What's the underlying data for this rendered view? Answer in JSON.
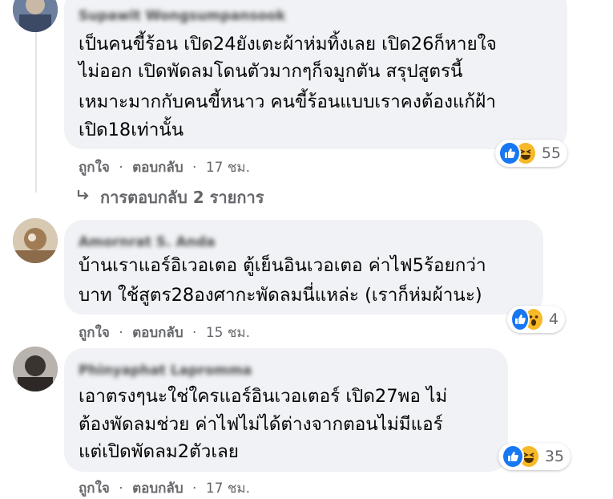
{
  "comments": [
    {
      "author": "Supawit Wongsumpansook",
      "lines": [
        "เป็นคนขี้ร้อน เปิด24ยังเตะผ้าห่มทิ้งเลย เปิด26ก็หายใจ",
        "ไม่ออก เปิดพัดลมโดนตัวมากๆก็จมูกตัน สรุปสูตรนี้",
        "เหมาะมากกับคนขี้หนาว คนขี้ร้อนแบบเราคงต้องแก้ฝ้า",
        "เปิด18เท่านั้น"
      ],
      "like_label": "ถูกใจ",
      "reply_label": "ตอบกลับ",
      "separator": "·",
      "time": "17 ชม.",
      "reaction_icons": [
        "like-icon",
        "haha-icon"
      ],
      "reaction_count": "55"
    },
    {
      "author": "Amornrat S. Anda",
      "lines": [
        "บ้านเราแอร์อิเวอเตอ ตู้เย็นอินเวอเตอ ค่าไฟ5ร้อยกว่า",
        "บาท ใช้สูตร28องศากะพัดลมนี่แหล่ะ (เราก็ห่มผ้านะ)"
      ],
      "like_label": "ถูกใจ",
      "reply_label": "ตอบกลับ",
      "separator": "·",
      "time": "15 ชม.",
      "reaction_icons": [
        "like-icon",
        "wow-icon"
      ],
      "reaction_count": "4"
    },
    {
      "author": "Phinyaphat Lapromma",
      "lines": [
        "เอาตรงๆนะใช่ใครแอร์อินเวอเตอร์ เปิด27พอ ไม่",
        "ต้องพัดลมช่วย ค่าไฟไม่ได้ต่างจากตอนไม่มีแอร์",
        "แต่เปิดพัดลม2ตัวเลย"
      ],
      "like_label": "ถูกใจ",
      "reply_label": "ตอบกลับ",
      "separator": "·",
      "time": "17 ชม.",
      "reaction_icons": [
        "like-icon",
        "haha-icon"
      ],
      "reaction_count": "35"
    }
  ],
  "replies_link": "การตอบกลับ 2 รายการ",
  "colors": {
    "bubble": "#f0f2f5",
    "meta_text": "#65676b",
    "like_blue": "#1877f2",
    "emoji_yellow": "#f7b928"
  }
}
